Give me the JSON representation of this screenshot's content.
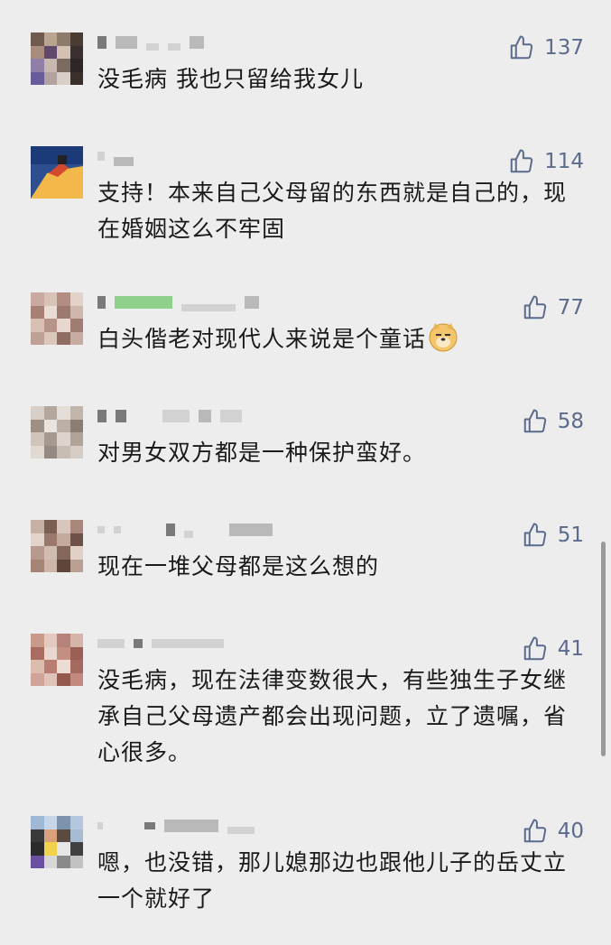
{
  "comments": [
    {
      "likes": "137",
      "text": "没毛病 我也只留给我女儿"
    },
    {
      "likes": "114",
      "text": "支持！本来自己父母留的东西就是自己的，现在婚姻这么不牢固"
    },
    {
      "likes": "77",
      "text": "白头偕老对现代人来说是个童话"
    },
    {
      "likes": "58",
      "text": "对男女双方都是一种保护蛮好。"
    },
    {
      "likes": "51",
      "text": "现在一堆父母都是这么想的"
    },
    {
      "likes": "41",
      "text": "没毛病，现在法律变数很大，有些独生子女继承自己父母遗产都会出现问题，立了遗嘱，省心很多。"
    },
    {
      "likes": "40",
      "text": "嗯，也没错，那儿媳那边也跟他儿子的岳丈立一个就好了"
    }
  ],
  "icons": {
    "like": "thumbs-up-icon",
    "emoji": "doge-emoji-icon"
  },
  "colors": {
    "background": "#ededed",
    "like_text": "#5b6b8c",
    "text": "#1a1a1a"
  }
}
